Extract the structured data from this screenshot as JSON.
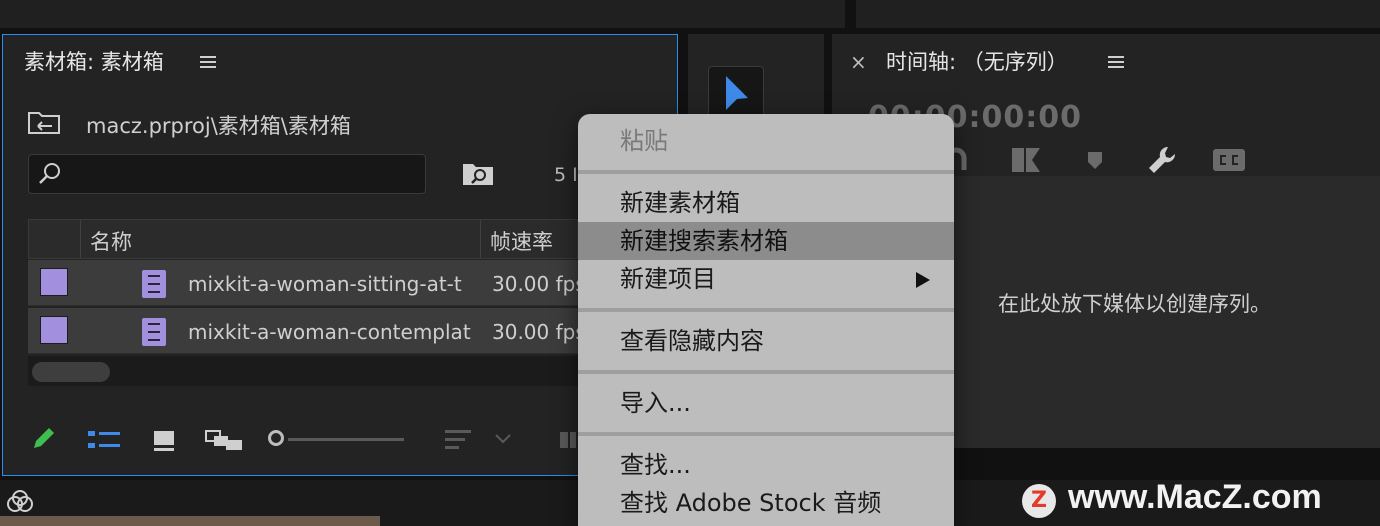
{
  "project_panel": {
    "title": "素材箱: 素材箱",
    "path": "macz.prproj\\素材箱\\素材箱",
    "search_placeholder": "",
    "item_count": "5 I",
    "columns": {
      "name": "名称",
      "fps": "帧速率"
    },
    "rows": [
      {
        "name": "mixkit-a-woman-sitting-at-t",
        "fps": "30.00 fps"
      },
      {
        "name": "mixkit-a-woman-contemplat",
        "fps": "30.00 fps"
      }
    ],
    "label_color": "#a28fdd"
  },
  "timeline_panel": {
    "title": "时间轴: （无序列）",
    "timecode": "00:00:00:00",
    "drop_hint": "在此处放下媒体以创建序列。"
  },
  "context_menu": {
    "items": [
      {
        "label": "粘贴",
        "disabled": true
      },
      {
        "label": "新建素材箱"
      },
      {
        "label": "新建搜索素材箱",
        "highlighted": true
      },
      {
        "label": "新建项目",
        "submenu": true
      },
      {
        "label": "查看隐藏内容"
      },
      {
        "label": "导入..."
      },
      {
        "label": "查找..."
      },
      {
        "label": "查找 Adobe Stock 音频"
      }
    ]
  },
  "watermark": {
    "logo_letter": "Z",
    "text": "www.MacZ.com"
  },
  "colors": {
    "accent": "#2d8ceb",
    "selection_tool": "#3f8ae8",
    "pencil": "#3fbf4f",
    "list_view": "#3f8ae8"
  }
}
